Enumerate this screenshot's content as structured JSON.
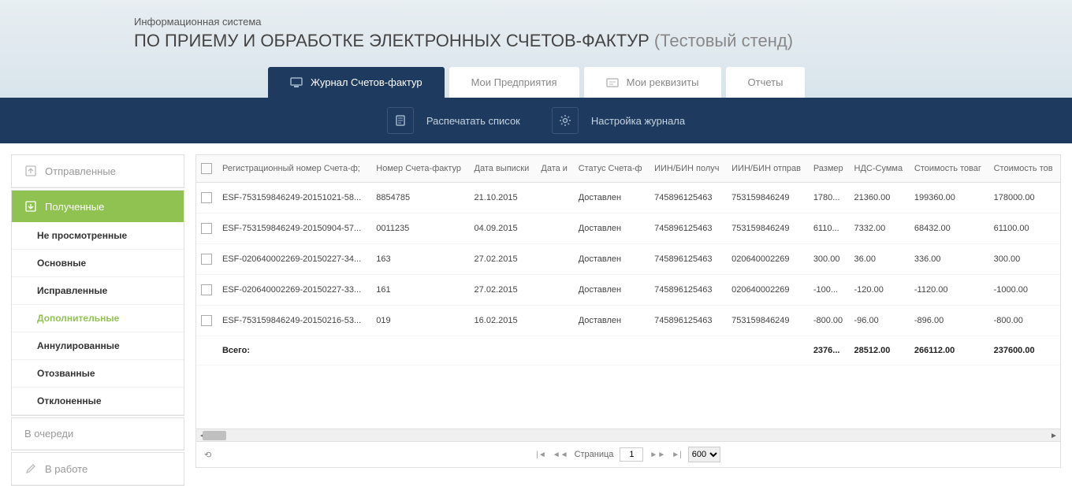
{
  "header": {
    "subtitle": "Информационная система",
    "title_main": "ПО ПРИЕМУ И ОБРАБОТКЕ ЭЛЕКТРОННЫХ СЧЕТОВ-ФАКТУР",
    "title_suffix": "(Тестовый стенд)"
  },
  "tabs": [
    {
      "label": "Журнал Счетов-фактур",
      "active": true
    },
    {
      "label": "Мои Предприятия",
      "active": false
    },
    {
      "label": "Мои реквизиты",
      "active": false
    },
    {
      "label": "Отчеты",
      "active": false
    }
  ],
  "toolbar": {
    "print_label": "Распечатать список",
    "settings_label": "Настройка журнала"
  },
  "sidebar": {
    "sent_label": "Отправленные",
    "received_label": "Полученные",
    "sub_items": [
      {
        "label": "Не просмотренные"
      },
      {
        "label": "Основные"
      },
      {
        "label": "Исправленные"
      },
      {
        "label": "Дополнительные",
        "highlight": true
      },
      {
        "label": "Аннулированные"
      },
      {
        "label": "Отозванные"
      },
      {
        "label": "Отклоненные"
      }
    ],
    "queue_label": "В очереди",
    "work_label": "В работе"
  },
  "table": {
    "headers": [
      "Регистрационный номер Счета-ф;",
      "Номер Счета-фактур",
      "Дата выписки",
      "Дата и",
      "Статус Счета-ф",
      "ИИН/БИН получ",
      "ИИН/БИН отправ",
      "Размер",
      "НДС-Сумма",
      "Стоимость товаг",
      "Стоимость тов"
    ],
    "rows": [
      {
        "reg": "ESF-753159846249-20151021-58...",
        "num": "8854785",
        "date": "21.10.2015",
        "dt": "",
        "status": "Доставлен",
        "iin_r": "745896125463",
        "iin_s": "753159846249",
        "size": "1780...",
        "nds": "21360.00",
        "cost1": "199360.00",
        "cost2": "178000.00"
      },
      {
        "reg": "ESF-753159846249-20150904-57...",
        "num": "0011235",
        "date": "04.09.2015",
        "dt": "",
        "status": "Доставлен",
        "iin_r": "745896125463",
        "iin_s": "753159846249",
        "size": "6110...",
        "nds": "7332.00",
        "cost1": "68432.00",
        "cost2": "61100.00"
      },
      {
        "reg": "ESF-020640002269-20150227-34...",
        "num": "163",
        "date": "27.02.2015",
        "dt": "",
        "status": "Доставлен",
        "iin_r": "745896125463",
        "iin_s": "020640002269",
        "size": "300.00",
        "nds": "36.00",
        "cost1": "336.00",
        "cost2": "300.00"
      },
      {
        "reg": "ESF-020640002269-20150227-33...",
        "num": "161",
        "date": "27.02.2015",
        "dt": "",
        "status": "Доставлен",
        "iin_r": "745896125463",
        "iin_s": "020640002269",
        "size": "-100...",
        "nds": "-120.00",
        "cost1": "-1120.00",
        "cost2": "-1000.00"
      },
      {
        "reg": "ESF-753159846249-20150216-53...",
        "num": "019",
        "date": "16.02.2015",
        "dt": "",
        "status": "Доставлен",
        "iin_r": "745896125463",
        "iin_s": "753159846249",
        "size": "-800.00",
        "nds": "-96.00",
        "cost1": "-896.00",
        "cost2": "-800.00"
      }
    ],
    "total_label": "Всего:",
    "totals": {
      "size": "2376...",
      "nds": "28512.00",
      "cost1": "266112.00",
      "cost2": "237600.00"
    }
  },
  "pager": {
    "page_label": "Страница",
    "page_value": "1",
    "page_size": "600"
  }
}
